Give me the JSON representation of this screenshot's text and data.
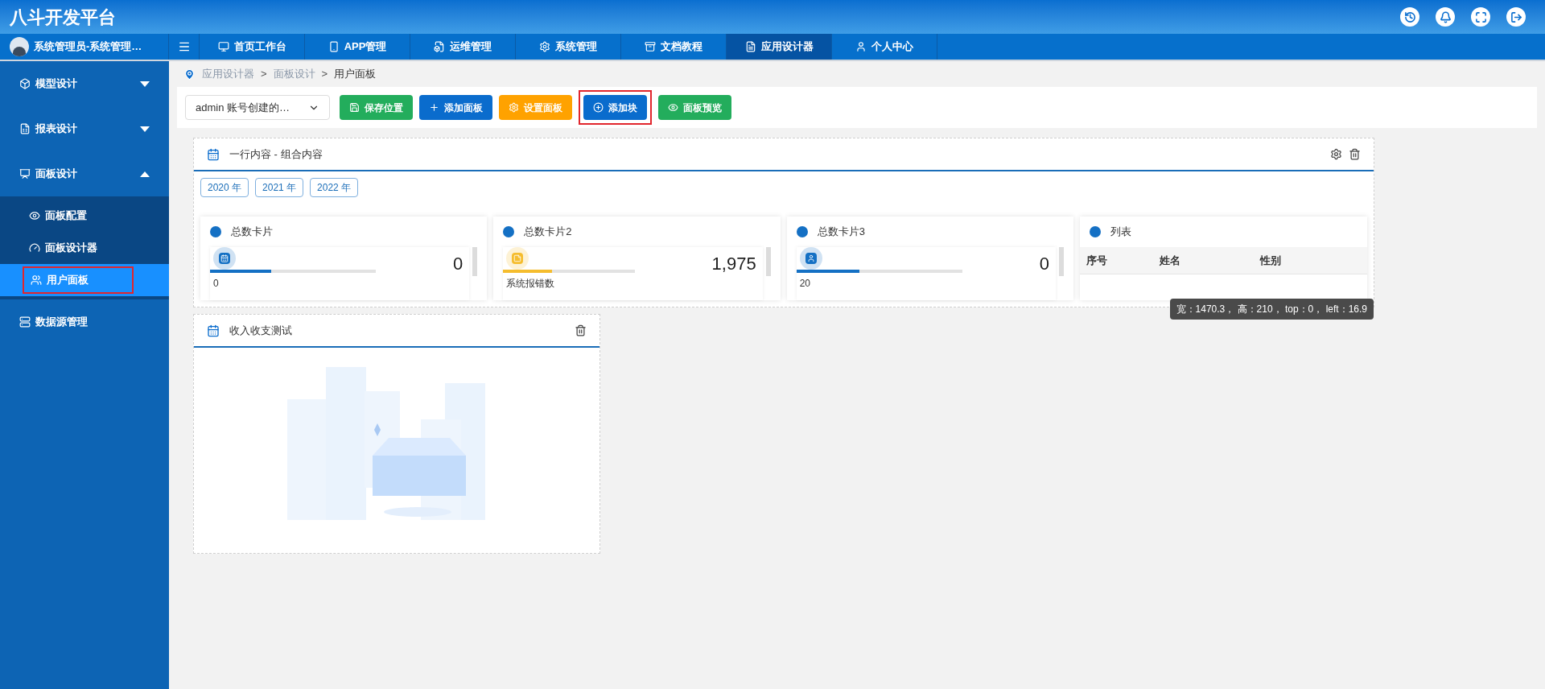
{
  "app_title": "八斗开发平台",
  "user": {
    "name": "系统管理员-系统管理…"
  },
  "nav_tabs": [
    {
      "label": "首页工作台",
      "selected": false
    },
    {
      "label": "APP管理",
      "selected": false
    },
    {
      "label": "运维管理",
      "selected": false
    },
    {
      "label": "系统管理",
      "selected": false
    },
    {
      "label": "文档教程",
      "selected": false
    },
    {
      "label": "应用设计器",
      "selected": true
    },
    {
      "label": "个人中心",
      "selected": false
    }
  ],
  "sidebar": {
    "items": [
      {
        "kind": "group",
        "label": "模型设计",
        "expanded": false
      },
      {
        "kind": "group",
        "label": "报表设计",
        "expanded": false
      },
      {
        "kind": "group",
        "label": "面板设计",
        "expanded": true,
        "children": [
          {
            "label": "面板配置",
            "selected": false,
            "highlighted": false
          },
          {
            "label": "面板设计器",
            "selected": false,
            "highlighted": false
          },
          {
            "label": "用户面板",
            "selected": true,
            "highlighted": true
          }
        ]
      },
      {
        "kind": "link",
        "label": "数据源管理"
      }
    ]
  },
  "breadcrumb": {
    "items": [
      "应用设计器",
      "面板设计",
      "用户面板"
    ],
    "separator": ">"
  },
  "toolbar": {
    "select": {
      "value": "admin 账号创建的…"
    },
    "buttons": [
      {
        "label": "保存位置",
        "color": "#23ad5c",
        "highlighted": false
      },
      {
        "label": "添加面板",
        "color": "#0a6ccd",
        "highlighted": false
      },
      {
        "label": "设置面板",
        "color": "#ffa200",
        "highlighted": false
      },
      {
        "label": "添加块",
        "color": "#0a6ccd",
        "highlighted": true
      },
      {
        "label": "面板预览",
        "color": "#23ad5c",
        "highlighted": false
      }
    ]
  },
  "panels": [
    {
      "kind": "composite",
      "title": "一行内容 - 组合内容",
      "has_settings": true,
      "year_tags": [
        "2020 年",
        "2021 年",
        "2022 年"
      ],
      "cards": [
        {
          "kind": "stat",
          "title": "总数卡片",
          "value": "0",
          "caption": "0",
          "level": 0.37,
          "color": "#1470c4"
        },
        {
          "kind": "stat",
          "title": "总数卡片2",
          "value": "1,975",
          "caption": "系统报错数",
          "level": 0.37,
          "color": "#f5bd2e"
        },
        {
          "kind": "stat",
          "title": "总数卡片3",
          "value": "0",
          "caption": "20",
          "level": 0.38,
          "color": "#1470c4"
        },
        {
          "kind": "table",
          "title": "列表",
          "columns": [
            "序号",
            "姓名",
            "性别"
          ]
        }
      ],
      "tooltip": "宽：1470.3， 高：210， top：0， left：16.9"
    },
    {
      "kind": "empty",
      "title": "收入收支测试",
      "has_settings": false
    }
  ]
}
